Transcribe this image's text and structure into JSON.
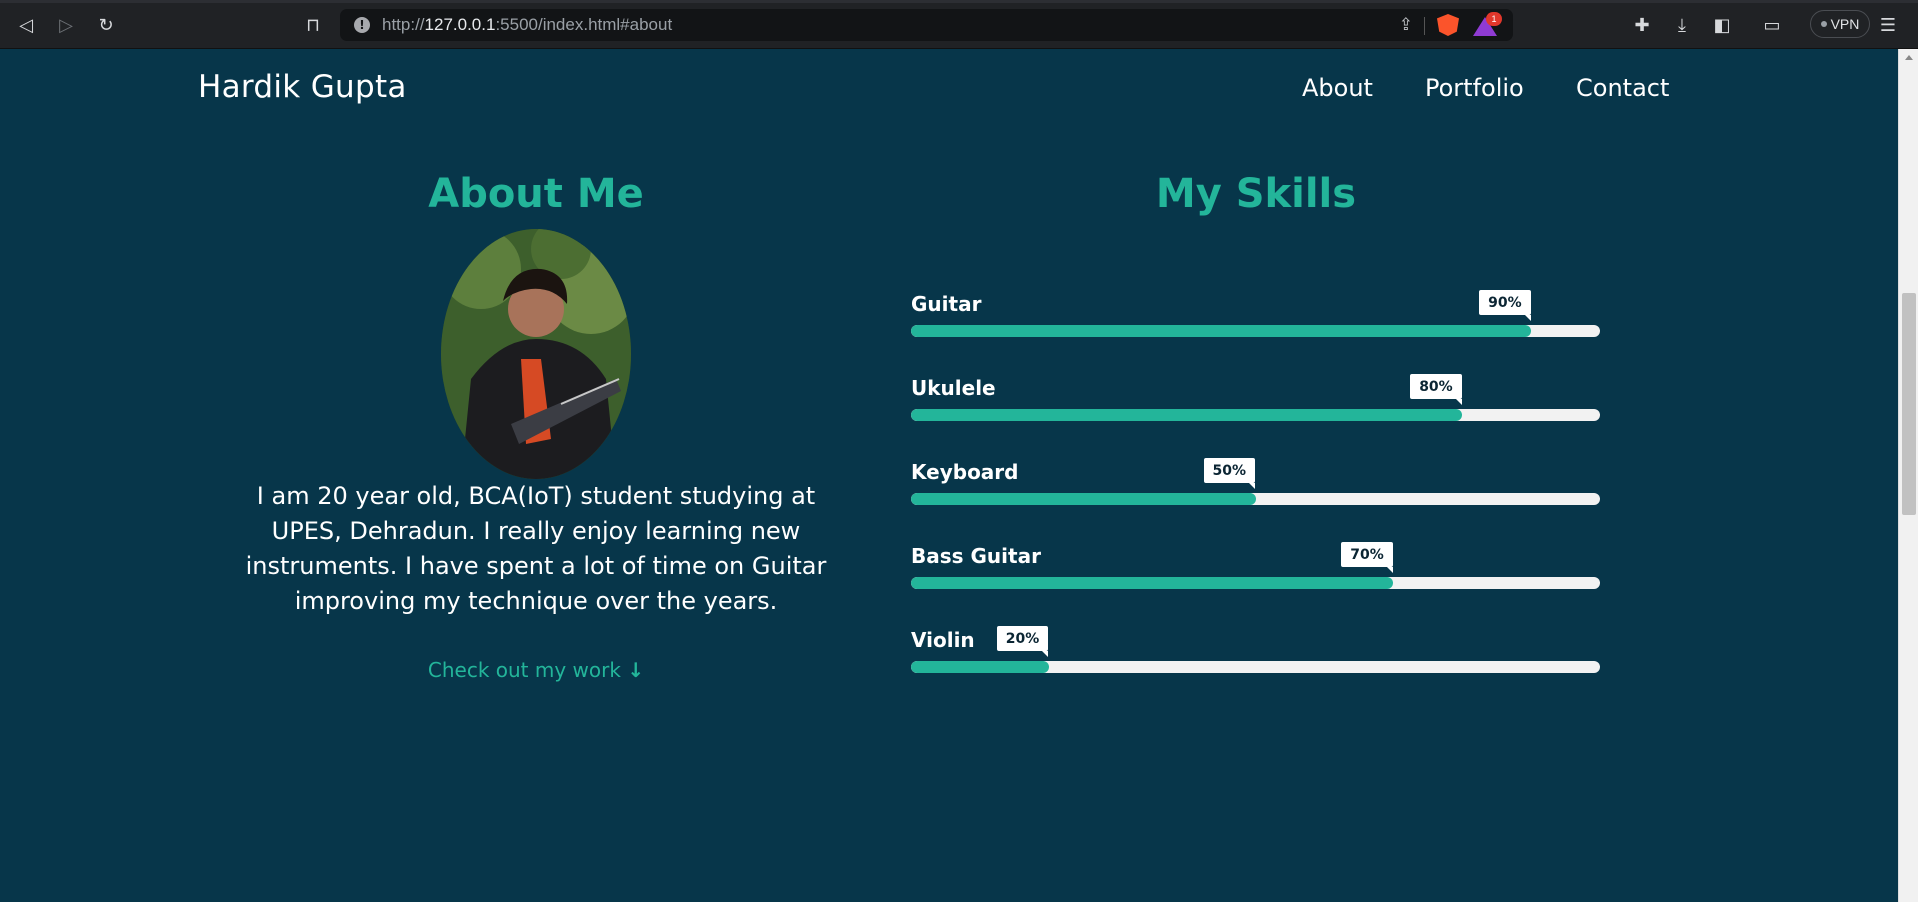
{
  "browser": {
    "url_prefix": "http://",
    "url_host": "127.0.0.1",
    "url_rest": ":5500/index.html#about",
    "vpn_label": "VPN",
    "notification_count": "1"
  },
  "site": {
    "logo": "Hardik Gupta",
    "nav": [
      {
        "label": "About"
      },
      {
        "label": "Portfolio"
      },
      {
        "label": "Contact"
      }
    ]
  },
  "about": {
    "heading": "About Me",
    "text": "I am 20 year old, BCA(IoT) student studying at UPES, Dehradun. I really enjoy learning new instruments. I have spent a lot of time on Guitar improving my technique over the years.",
    "cta": "Check out my work"
  },
  "skills": {
    "heading": "My Skills",
    "items": [
      {
        "name": "Guitar",
        "percent_label": "90%",
        "value": 90
      },
      {
        "name": "Ukulele",
        "percent_label": "80%",
        "value": 80
      },
      {
        "name": "Keyboard",
        "percent_label": "50%",
        "value": 50
      },
      {
        "name": "Bass Guitar",
        "percent_label": "70%",
        "value": 70
      },
      {
        "name": "Violin",
        "percent_label": "20%",
        "value": 20
      }
    ]
  },
  "colors": {
    "background": "#07364a",
    "accent": "#23b59a",
    "text": "#ffffff",
    "track": "#f2f2f2"
  }
}
